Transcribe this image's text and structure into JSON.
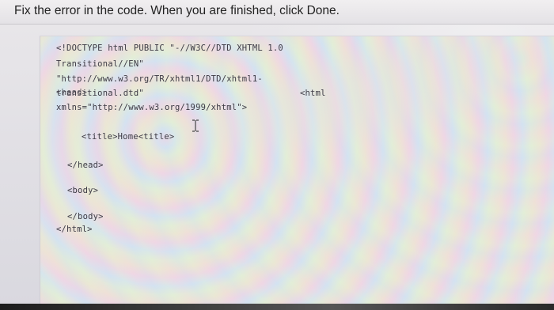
{
  "header": {
    "instruction": "Fix the error in the code. When you are finished, click Done."
  },
  "editor": {
    "lines": {
      "doctype_1": "<!DOCTYPE html PUBLIC \"-//W3C//DTD XHTML 1.0",
      "doctype_2": "Transitional//EN\"",
      "doctype_3": "\"http://www.w3.org/TR/xhtml1/DTD/xhtml1-",
      "doctype_4": "transitional.dtd\"",
      "html_open": "<html",
      "xmlns": "xmlns=\"http://www.w3.org/1999/xhtml\">",
      "head_open": "<head>",
      "title": "<title>Home<title>",
      "head_close": "</head>",
      "body_open": "<body>",
      "body_close": "</body>",
      "html_close": "</html>"
    }
  },
  "cursor": {
    "icon": "text-cursor-icon"
  }
}
